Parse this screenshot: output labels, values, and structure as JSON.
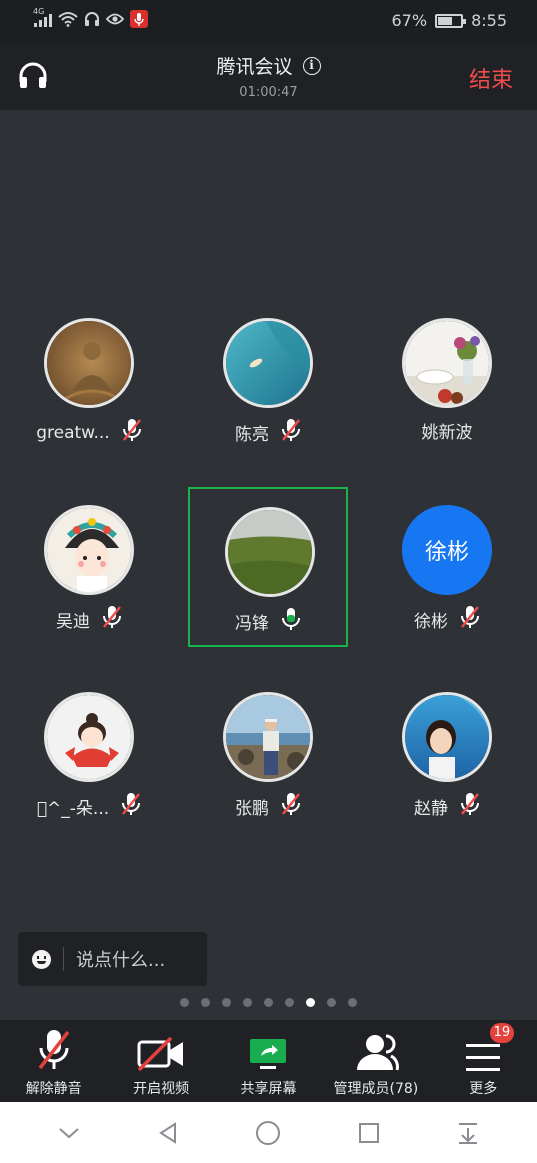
{
  "status_bar": {
    "network": "4G",
    "battery_percent": "67%",
    "battery_level": 0.67,
    "time": "8:55"
  },
  "header": {
    "title": "腾讯会议",
    "timer": "01:00:47",
    "end_label": "结束"
  },
  "participants": [
    {
      "name": "greatw...",
      "mic": "muted",
      "avatar": "buddha-mural-image"
    },
    {
      "name": "陈亮",
      "mic": "muted",
      "avatar": "aerial-sea-image"
    },
    {
      "name": "姚新波",
      "mic": "none",
      "avatar": "table-food-image"
    },
    {
      "name": "吴迪",
      "mic": "muted",
      "avatar": "cartoon-empress-image"
    },
    {
      "name": "冯锋",
      "mic": "active",
      "avatar": "grassland-image"
    },
    {
      "name": "徐彬",
      "mic": "muted",
      "avatar": "text",
      "avatar_text": "徐彬"
    },
    {
      "name": "\u0000^_-朵...",
      "mic": "muted",
      "avatar": "cartoon-girl-image"
    },
    {
      "name": "张鹏",
      "mic": "muted",
      "avatar": "man-at-beach-image"
    },
    {
      "name": "赵静",
      "mic": "muted",
      "avatar": "child-aquarium-image"
    }
  ],
  "chat": {
    "placeholder": "说点什么..."
  },
  "pager": {
    "count": 9,
    "active": 6
  },
  "toolbar": [
    {
      "label": "解除静音",
      "icon": "mic-muted-icon"
    },
    {
      "label": "开启视频",
      "icon": "video-off-icon"
    },
    {
      "label": "共享屏幕",
      "icon": "share-screen-icon"
    },
    {
      "label": "管理成员(78)",
      "icon": "members-icon"
    },
    {
      "label": "更多",
      "icon": "menu-icon",
      "badge": "19"
    }
  ],
  "colors": {
    "accent_green": "#19b34a",
    "end_red": "#f04b4b",
    "avatar_blue": "#1777f3",
    "badge_red": "#e5413d"
  }
}
